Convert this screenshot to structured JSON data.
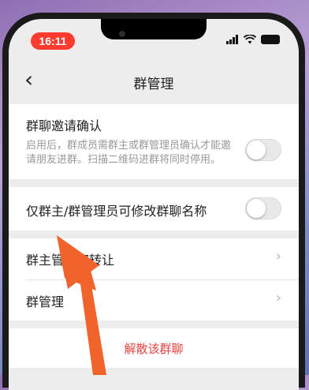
{
  "status_bar": {
    "time": "16:11"
  },
  "nav": {
    "back_icon": "chevron-left-icon",
    "title": "群管理"
  },
  "invite_confirm": {
    "title": "群聊邀请确认",
    "description": "启用后，群成员需群主或群管理员确认才能邀请朋友进群。扫描二维码进群将同时停用。",
    "enabled": false
  },
  "only_admin_rename": {
    "title": "仅群主/群管理员可修改群聊名称",
    "enabled": false
  },
  "transfer_owner": {
    "title": "群主管理权转让"
  },
  "group_admins": {
    "title": "群管理"
  },
  "dissolve": {
    "label": "解散该群聊"
  },
  "colors": {
    "danger": "#e64340",
    "arrow": "#f0632b",
    "time_pill": "#ff3b30"
  }
}
